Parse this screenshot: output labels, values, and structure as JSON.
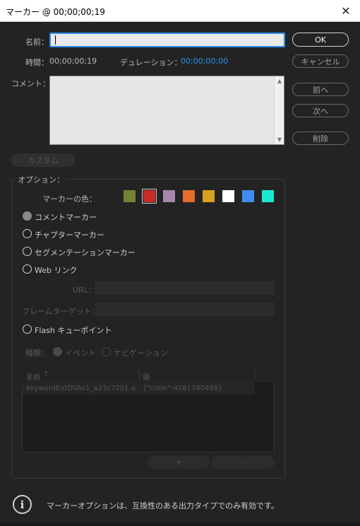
{
  "window": {
    "title": "マーカー @ 00;00;00;19"
  },
  "name": {
    "label": "名前：",
    "value": ""
  },
  "time": {
    "label": "時間：",
    "value": "00;00;00;19"
  },
  "duration": {
    "label": "デュレーション：",
    "value": "00;00;00;00"
  },
  "comment": {
    "label": "コメント：",
    "value": ""
  },
  "buttons": {
    "ok": "OK",
    "cancel": "キャンセル",
    "prev": "前へ",
    "next": "次へ",
    "delete": "削除",
    "custom": "カスタム"
  },
  "options": {
    "label": "オプション：",
    "marker_color_label": "マーカーの色：",
    "colors": [
      "#768233",
      "#c92a2a",
      "#a887aa",
      "#e46d2c",
      "#d6a021",
      "#ffffff",
      "#3f8cf2",
      "#1ae9d3"
    ],
    "selected_color_index": 1,
    "types": [
      {
        "label": "コメントマーカー",
        "selected": true
      },
      {
        "label": "チャプターマーカー",
        "selected": false
      },
      {
        "label": "セグメンテーションマーカー",
        "selected": false
      },
      {
        "label": "Web リンク",
        "selected": false
      }
    ],
    "url_label": "URL：",
    "frame_target_label": "フレームターゲット：",
    "flash_label": "Flash キューポイント",
    "kind_label": "種類：",
    "kind_event": "イベント",
    "kind_navigation": "ナビゲーション",
    "table": {
      "col_name": "名前",
      "col_value": "値",
      "sort_icon": "arrow-up-icon",
      "rows": [
        {
          "name": "keywordExtDVAv1_a23c7201-a",
          "value": "{\"color\":4281740498}"
        }
      ]
    },
    "add_label": "+",
    "remove_label": "-"
  },
  "info": {
    "text": "マーカーオプションは、互換性のある出力タイプでのみ有効です。"
  }
}
